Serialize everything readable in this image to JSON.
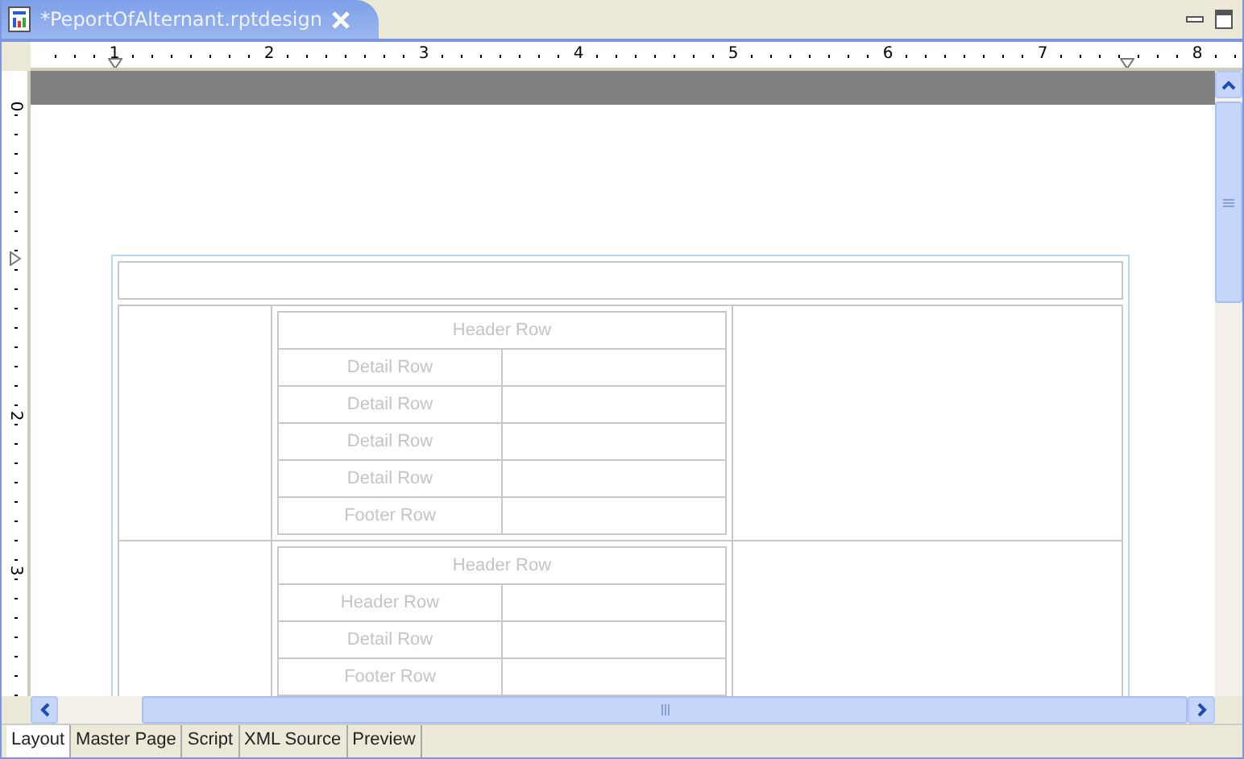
{
  "editor_tab": {
    "title": "*PeportOfAlternant.rptdesign"
  },
  "horizontal_ruler": [
    "1",
    "2",
    "3",
    "4",
    "5",
    "6",
    "7",
    "8"
  ],
  "vertical_ruler": [
    {
      "kind": "number",
      "label": "0"
    },
    {
      "kind": "marker"
    },
    {
      "kind": "number",
      "label": "2"
    },
    {
      "kind": "number",
      "label": "3"
    }
  ],
  "grid_rows": [
    {
      "header": "Header Row",
      "rows": [
        "Detail Row",
        "Detail Row",
        "Detail Row",
        "Detail Row",
        "Footer Row"
      ]
    },
    {
      "header": "Header Row",
      "rows": [
        "Header Row",
        "Detail Row",
        "Footer Row"
      ]
    }
  ],
  "bottom_tabs": [
    {
      "label": "Layout",
      "selected": true
    },
    {
      "label": "Master Page",
      "selected": false
    },
    {
      "label": "Script",
      "selected": false
    },
    {
      "label": "XML Source",
      "selected": false
    },
    {
      "label": "Preview",
      "selected": false
    }
  ]
}
